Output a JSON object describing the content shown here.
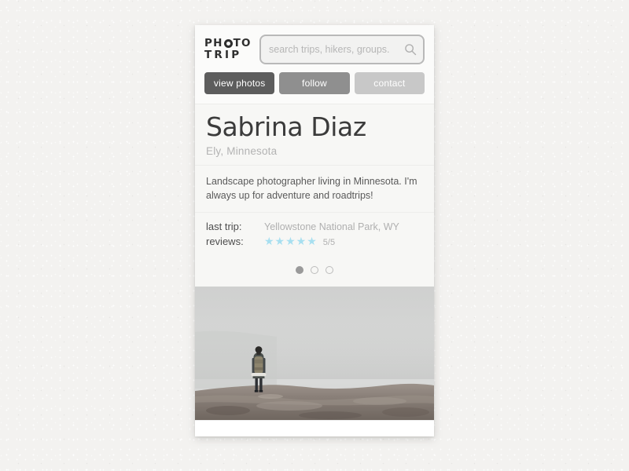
{
  "page": {
    "background_color": "#f3f2f0",
    "card_background": "#fbfbfa"
  },
  "header": {
    "logo": {
      "line1_before": "PH",
      "logo_lens_icon": "camera-lens-icon",
      "line1_after": "TO",
      "line2": "TRIP"
    },
    "search": {
      "placeholder": "search trips, hikers, groups.",
      "value": "",
      "icon": "search-icon"
    }
  },
  "actions": {
    "buttons": [
      {
        "label": "view photos",
        "color": "#5d5d5d"
      },
      {
        "label": "follow",
        "color": "#8f8f8f"
      },
      {
        "label": "contact",
        "color": "#c8c8c8"
      }
    ]
  },
  "profile": {
    "name": "Sabrina Diaz",
    "location": "Ely, Minnesota",
    "bio": "Landscape photographer living in Minnesota. I'm always up for adventure and roadtrips!",
    "meta": [
      {
        "label": "last trip:",
        "value": "Yellowstone National Park, WY"
      }
    ],
    "reviews": {
      "label": "reviews:",
      "stars": "★★★★★",
      "star_count": 5,
      "star_color": "#a7dff0",
      "rating_text": "5/5"
    }
  },
  "carousel": {
    "total": 3,
    "active_index": 0,
    "dots": [
      "active",
      "inactive",
      "inactive"
    ]
  },
  "photo": {
    "alt": "Hiker with backpack standing on a foggy rocky ridge",
    "sky_color": "#d2d3d2",
    "rock_color": "#8d8379"
  }
}
